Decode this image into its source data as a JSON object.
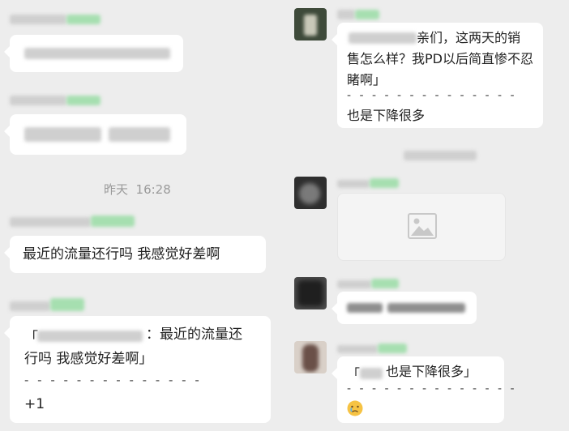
{
  "chat": {
    "timestamp": "昨天  16:28",
    "left": {
      "msg1": "最近的流量还行吗 我感觉好差啊",
      "quote_text": "：最近的流量还行吗 我感觉好差啊」",
      "quote_text_line1": "：最近的流量还",
      "quote_text_line2": "行吗 我感觉好差啊」",
      "quote_dashes": "- - - - - - - - - - - - - -",
      "reply": "+1"
    },
    "right": {
      "msg1_line1": "亲们，这两天的销",
      "msg1_line2": "售怎么样？我PD以后简直惨不忍",
      "msg1_line3": "睹啊」",
      "msg1_dashes": "- - - - - - - - - - - - - -",
      "msg1_reply": "也是下降很多",
      "quote2_text": "也是下降很多」",
      "quote2_dashes": "- - - - - - - - - - - - - -",
      "emoji_name": "crying-face"
    }
  },
  "colors": {
    "background": "#ededed",
    "bubble": "#ffffff",
    "blur_green": "#a6dfb0"
  }
}
